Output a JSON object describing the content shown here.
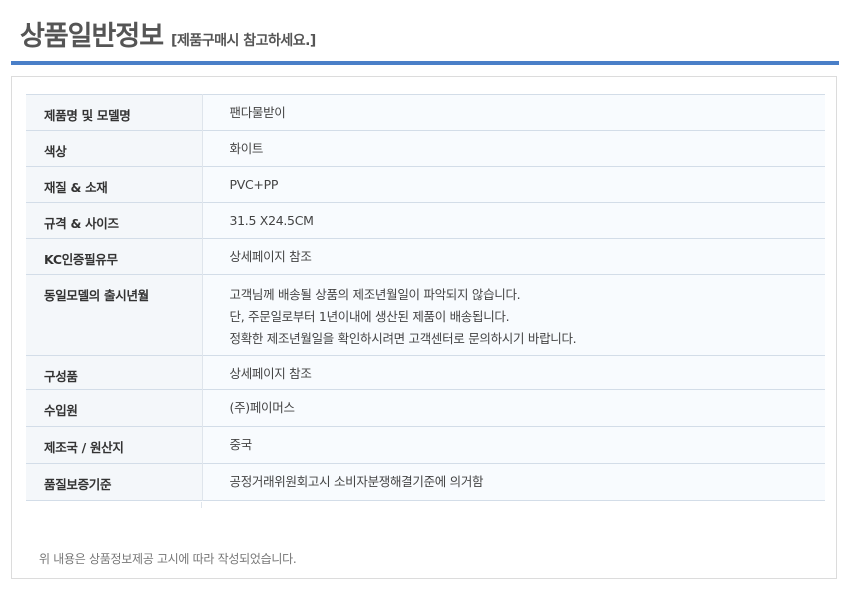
{
  "header": {
    "title": "상품일반정보",
    "subtitle": "[제품구매시 참고하세요.]"
  },
  "rows": [
    {
      "label": "제품명 및 모델명",
      "lines": [
        "팬다물받이"
      ]
    },
    {
      "label": "색상",
      "lines": [
        "화이트"
      ]
    },
    {
      "label": "재질 & 소재",
      "lines": [
        "PVC+PP"
      ]
    },
    {
      "label": "규격 & 사이즈",
      "lines": [
        "31.5 X24.5CM"
      ]
    },
    {
      "label": "KC인증필유무",
      "lines": [
        "상세페이지 참조"
      ]
    },
    {
      "label": "동일모델의 출시년월",
      "lines": [
        "고객님께 배송될 상품의 제조년월일이 파악되지 않습니다.",
        "단, 주문일로부터 1년이내에 생산된 제품이 배송됩니다.",
        "정확한 제조년월일을 확인하시려면 고객센터로 문의하시기 바랍니다."
      ]
    },
    {
      "label": "구성품",
      "lines": [
        "상세페이지 참조"
      ]
    },
    {
      "label": "수입원",
      "lines": [
        "(주)페이머스"
      ]
    },
    {
      "label": "제조국 / 원산지",
      "lines": [
        "중국"
      ]
    },
    {
      "label": "품질보증기준",
      "lines": [
        "공정거래위원회고시 소비자분쟁해결기준에 의거함"
      ]
    }
  ],
  "notice": "위 내용은 상품정보제공 고시에 따라 작성되었습니다.",
  "colors": {
    "accent_bar": "#4a7fc8",
    "label_bg": "#f4f7fa",
    "row_border": "#d3dde8"
  }
}
